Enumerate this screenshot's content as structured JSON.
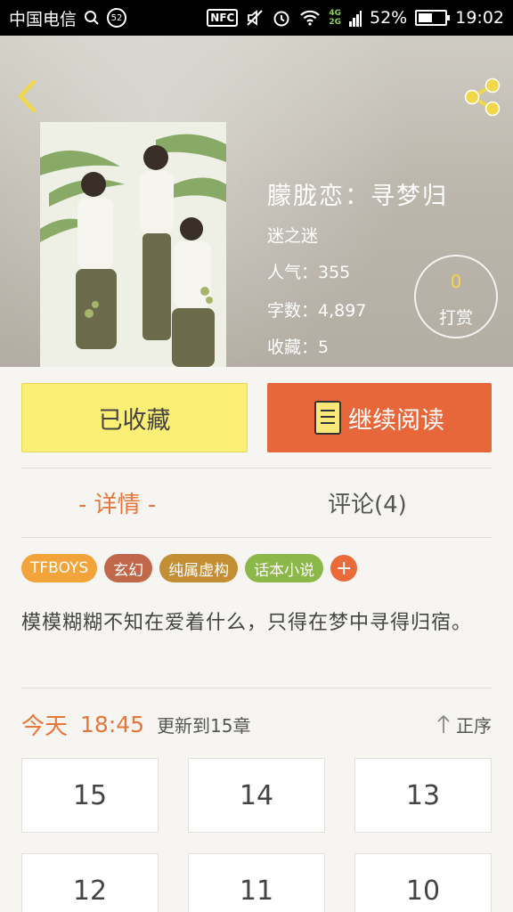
{
  "status_bar": {
    "carrier": "中国电信",
    "notif_count": "52",
    "nfc": "NFC",
    "net_top": "4G",
    "net_bottom": "2G",
    "battery": "52%",
    "battery_level": 0.52,
    "time": "19:02"
  },
  "header": {
    "back_icon": "back-arrow-icon",
    "share_icon": "share-icon"
  },
  "book": {
    "title": "朦胧恋：寻梦归",
    "author": "迷之迷",
    "popularity": "人气：355",
    "words": "字数：4,897",
    "favorites": "收藏：5",
    "reward_count": "0",
    "reward_label": "打赏"
  },
  "actions": {
    "favorited": "已收藏",
    "continue": "继续阅读"
  },
  "tabs": {
    "detail": "- 详情 -",
    "comments": "评论(4)"
  },
  "tags": [
    {
      "label": "TFBOYS",
      "color": "#f2a43a"
    },
    {
      "label": "玄幻",
      "color": "#c2684a"
    },
    {
      "label": "纯属虚构",
      "color": "#c48e34"
    },
    {
      "label": "话本小说",
      "color": "#8cb84a"
    }
  ],
  "tag_add": "+",
  "description": "模模糊糊不知在爱着什么，只得在梦中寻得归宿。",
  "update": {
    "day": "今天",
    "time": "18:45",
    "text": "更新到15章",
    "order": "正序"
  },
  "chapters": [
    "15",
    "14",
    "13",
    "12",
    "11",
    "10"
  ],
  "colors": {
    "accent": "#e8763a",
    "fav_button": "#fbef76",
    "read_button": "#e8673a"
  }
}
